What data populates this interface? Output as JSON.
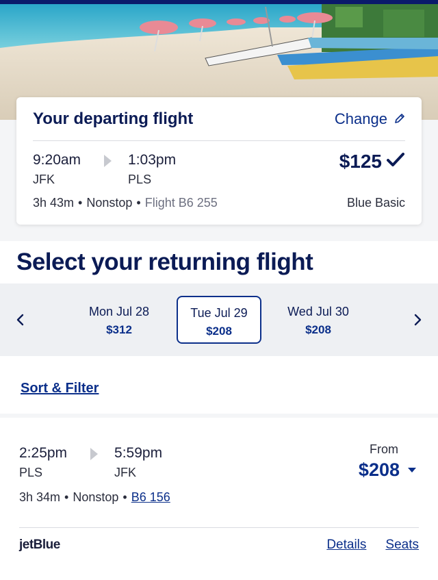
{
  "departing": {
    "title": "Your departing flight",
    "change_label": "Change",
    "depart_time": "9:20am",
    "depart_code": "JFK",
    "arrive_time": "1:03pm",
    "arrive_code": "PLS",
    "price": "$125",
    "duration": "3h 43m",
    "stops": "Nonstop",
    "flight": "Flight B6 255",
    "fare_class": "Blue Basic"
  },
  "returning": {
    "heading": "Select your returning flight"
  },
  "date_tabs": [
    {
      "day": "Mon Jul 28",
      "price": "$312",
      "selected": false
    },
    {
      "day": "Tue Jul 29",
      "price": "$208",
      "selected": true
    },
    {
      "day": "Wed Jul 30",
      "price": "$208",
      "selected": false
    }
  ],
  "sort_filter_label": "Sort & Filter",
  "result": {
    "depart_time": "2:25pm",
    "depart_code": "PLS",
    "arrive_time": "5:59pm",
    "arrive_code": "JFK",
    "from_label": "From",
    "price": "$208",
    "duration": "3h 34m",
    "stops": "Nonstop",
    "flight_link": "B6 156",
    "airline_logo": "jetBlue",
    "details_label": "Details",
    "seats_label": "Seats"
  },
  "icons": {
    "edit": "pencil-icon",
    "check": "checkmark-icon",
    "prev": "chevron-left-icon",
    "next": "chevron-right-icon",
    "dropdown": "caret-down-icon"
  },
  "colors": {
    "brand_navy": "#0b1b55",
    "link_blue": "#0b2f8a",
    "top_bar": "#0a1a6b"
  }
}
